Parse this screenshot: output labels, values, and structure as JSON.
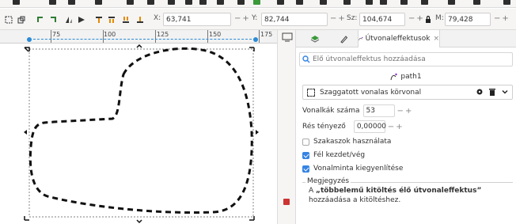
{
  "toolbar": {
    "x_label": "X:",
    "x_value": "63,741",
    "y_label": "Y:",
    "y_value": "82,744",
    "w_label": "Sz:",
    "w_value": "104,674",
    "h_label": "M:",
    "h_value": "79,428",
    "minus": "−",
    "plus": "+",
    "lock_icon": "lock-icon"
  },
  "ruler": {
    "ticks": [
      "75",
      "100",
      "125",
      "150",
      "175"
    ]
  },
  "panel": {
    "tabs": [
      {
        "icon": "layers-icon"
      },
      {
        "icon": "pen-icon"
      },
      {
        "icon": "path-effects-icon",
        "label": "Útvonaleffektusok",
        "close": "×"
      }
    ],
    "search_placeholder": "Élő útvonaleffektus hozzáadása",
    "path_name": "path1",
    "effect_name": "Szaggatott vonalas körvonal",
    "params": {
      "dash_count_label": "Vonalkák száma",
      "dash_count_value": "53",
      "gap_ratio_label": "Rés tényező",
      "gap_ratio_value": "0,00000",
      "use_segments_label": "Szakaszok használata",
      "half_start_end_label": "Fél kezdet/vég",
      "stroke_align_label": "Vonalminta kiegyenlítése"
    },
    "note_title": "Megjegyzés",
    "note_prefix": "A ",
    "note_bold": "„többelemű kitöltés élő útvonaleffektus”",
    "note_suffix": " hozzáadása a kitöltéshez."
  }
}
